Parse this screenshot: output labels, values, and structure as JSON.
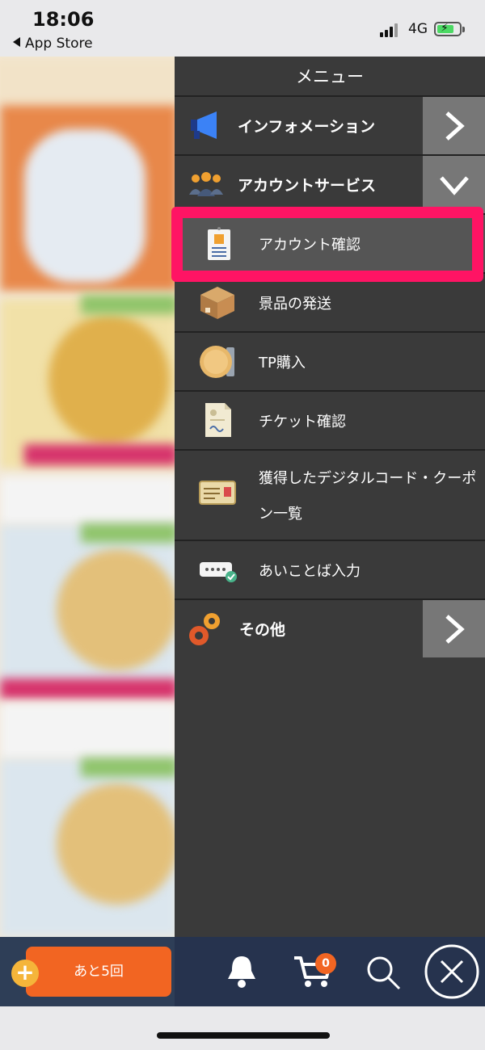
{
  "status_bar": {
    "time": "18:06",
    "back_label": "App Store",
    "network": "4G"
  },
  "drawer": {
    "title": "メニュー",
    "sections": {
      "information": {
        "label": "インフォメーション",
        "expanded": false
      },
      "account_services": {
        "label": "アカウントサービス",
        "expanded": true
      },
      "other": {
        "label": "その他",
        "expanded": false
      }
    },
    "items": [
      {
        "label": "アカウント確認",
        "icon": "id-card-icon",
        "highlighted": true
      },
      {
        "label": "景品の発送",
        "icon": "package-box-icon"
      },
      {
        "label": "TP購入",
        "icon": "coin-stack-icon"
      },
      {
        "label": "チケット確認",
        "icon": "ticket-document-icon"
      },
      {
        "label": "獲得したデジタルコード・クーポン一覧",
        "label_line1": "獲得したデジタルコード・クーポ",
        "label_line2": "ン一覧",
        "icon": "coupon-icon"
      },
      {
        "label": "あいことば入力",
        "icon": "password-input-icon"
      }
    ]
  },
  "bottom_bar": {
    "remaining_label": "あと5回",
    "cart_count": "0"
  },
  "colors": {
    "drawer_bg": "#3a3a3a",
    "highlight": "#ff1464",
    "accent_orange": "#f26522",
    "bottom_bar": "#26334e"
  }
}
